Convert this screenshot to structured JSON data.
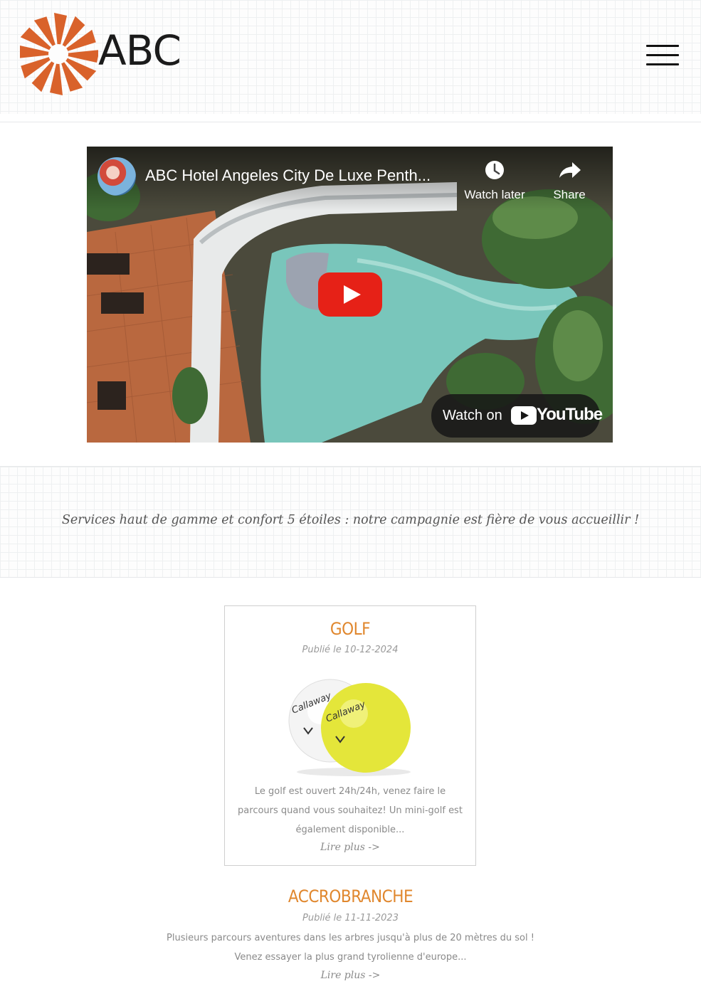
{
  "header": {
    "logo_text": "ABC",
    "logo_color": "#d9622b",
    "menu_icon": "hamburger-menu-icon"
  },
  "video": {
    "title": "ABC Hotel Angeles City De Luxe Penth...",
    "watch_later_label": "Watch later",
    "share_label": "Share",
    "watch_on_label": "Watch on",
    "youtube_label": "YouTube",
    "play_color": "#e62117"
  },
  "tagline": "Services haut de gamme et confort 5 étoiles : notre campagnie est fière de vous accueillir !",
  "posts": [
    {
      "title": "GOLF",
      "date": "Publié le 10-12-2024",
      "text_lines": [
        "Le golf est ouvert 24h/24h, venez faire le",
        "parcours quand vous souhaitez! Un mini-golf est",
        "également disponible..."
      ],
      "more": "Lire plus ->"
    },
    {
      "title": "ACCROBRANCHE",
      "date": "Publié le 11-11-2023",
      "text_lines": [
        "Plusieurs parcours aventures dans les arbres jusqu'à plus de 20 mètres du sol !",
        "Venez essayer la plus grand tyrolienne d'europe..."
      ],
      "more": "Lire plus ->"
    }
  ],
  "accent_color": "#e0872e"
}
